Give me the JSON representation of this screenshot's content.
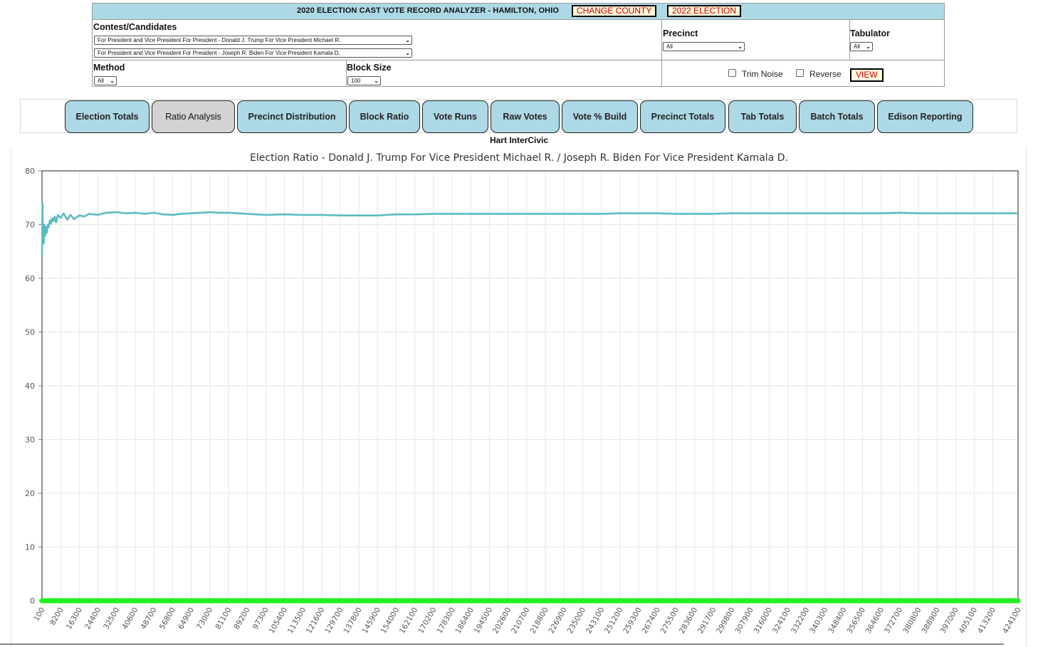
{
  "header": {
    "title": "2020 ELECTION CAST VOTE RECORD ANALYZER - HAMILTON, OHIO",
    "change_county": "CHANGE COUNTY",
    "election_2022": "2022 ELECTION"
  },
  "filters": {
    "contest_label": "Contest/Candidates",
    "candidate_1": "For President and Vice President For President - Donald J. Trump For Vice President Michael R.",
    "candidate_2": "For President and Vice President For President - Joseph R. Biden For Vice President Kamala D.",
    "precinct_label": "Precinct",
    "precinct_value": "All",
    "tabulator_label": "Tabulator",
    "tabulator_value": "All",
    "method_label": "Method",
    "method_value": "All",
    "block_size_label": "Block Size",
    "block_size_value": "100",
    "trim_noise_label": "Trim Noise",
    "reverse_label": "Reverse",
    "view_label": "VIEW"
  },
  "tabs": [
    {
      "label": "Election Totals",
      "active": false
    },
    {
      "label": "Ratio Analysis",
      "active": true
    },
    {
      "label": "Precinct Distribution",
      "active": false
    },
    {
      "label": "Block Ratio",
      "active": false
    },
    {
      "label": "Vote Runs",
      "active": false
    },
    {
      "label": "Raw Votes",
      "active": false
    },
    {
      "label": "Vote % Build",
      "active": false
    },
    {
      "label": "Precinct Totals",
      "active": false
    },
    {
      "label": "Tab Totals",
      "active": false
    },
    {
      "label": "Batch Totals",
      "active": false
    },
    {
      "label": "Edison Reporting",
      "active": false
    }
  ],
  "vendor": "Hart InterCivic",
  "colors": {
    "accent": "#add8e6",
    "active_tab": "#d3d3d3",
    "button_text": "#cc0000",
    "ratio_series": "#5bbcc0",
    "zero_series": "#22ee22"
  },
  "chart_data": {
    "type": "line",
    "title": "Election Ratio - Donald J. Trump For Vice President Michael R. / Joseph R. Biden For Vice President Kamala D.",
    "xlabel": "",
    "ylabel": "",
    "ylim": [
      0,
      80
    ],
    "yticks": [
      0,
      10,
      20,
      30,
      40,
      50,
      60,
      70,
      80
    ],
    "xlim": [
      100,
      424100
    ],
    "xticks": [
      100,
      8200,
      16300,
      24400,
      32500,
      40600,
      48700,
      56800,
      64900,
      73000,
      81100,
      89200,
      97300,
      105400,
      113500,
      121600,
      129700,
      137800,
      145900,
      154000,
      162100,
      170200,
      178300,
      186400,
      194500,
      202600,
      210700,
      218800,
      226900,
      235000,
      243100,
      251200,
      259300,
      267400,
      275500,
      283600,
      291700,
      299800,
      307900,
      316000,
      324100,
      332200,
      340300,
      348400,
      356500,
      364600,
      372700,
      380800,
      388900,
      397000,
      405100,
      413200,
      424100
    ],
    "grid": true,
    "legend": "none",
    "series": [
      {
        "x": [
          100,
          300,
          500,
          700,
          900,
          1200,
          1500,
          1800,
          2200,
          2600,
          3000,
          3500,
          4000,
          4500,
          5000,
          5600,
          6200,
          7000,
          8200,
          9500,
          11000,
          12500,
          14000,
          16300,
          18500,
          20500,
          24400,
          28000,
          32500,
          36500,
          40600,
          44500,
          48700,
          52500,
          56800,
          60500,
          64900,
          69000,
          73000,
          77000,
          81100,
          89200,
          97300,
          105400,
          113500,
          121600,
          129700,
          137800,
          145900,
          154000,
          162100,
          170200,
          178300,
          186400,
          194500,
          202600,
          210700,
          218800,
          226900,
          235000,
          243100,
          251200,
          259300,
          267400,
          275500,
          283600,
          291700,
          299800,
          307900,
          316000,
          324100,
          332200,
          340300,
          348400,
          356500,
          364600,
          372700,
          380800,
          388900,
          397000,
          405100,
          413200,
          424100
        ],
        "values": [
          64,
          74,
          67,
          69,
          66.5,
          70,
          68,
          69.5,
          68.5,
          70,
          69.5,
          70.8,
          70.2,
          71.2,
          70.6,
          71.5,
          70.4,
          71.8,
          71.2,
          72.1,
          70.9,
          71.8,
          71.0,
          71.7,
          71.5,
          72.0,
          71.8,
          72.2,
          72.3,
          72.1,
          72.2,
          72.0,
          72.2,
          71.9,
          71.8,
          72.0,
          72.1,
          72.2,
          72.3,
          72.2,
          72.2,
          72.0,
          71.8,
          71.9,
          71.8,
          71.8,
          71.7,
          71.7,
          71.7,
          71.9,
          71.9,
          72.0,
          72.0,
          72.0,
          72.0,
          72.0,
          72.0,
          72.0,
          72.0,
          72.0,
          72.0,
          72.1,
          72.1,
          72.1,
          72.0,
          72.0,
          72.0,
          72.1,
          72.1,
          72.1,
          72.1,
          72.1,
          72.1,
          72.1,
          72.1,
          72.1,
          72.2,
          72.1,
          72.1,
          72.1,
          72.1,
          72.1,
          72.1
        ]
      },
      {
        "x": [
          100,
          424100
        ],
        "values": [
          0,
          0
        ]
      }
    ]
  }
}
